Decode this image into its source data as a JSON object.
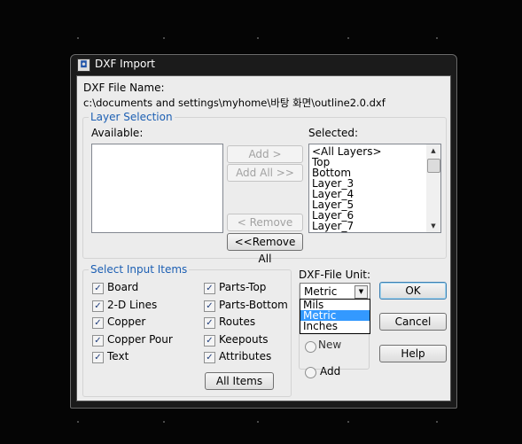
{
  "window": {
    "title": "DXF Import"
  },
  "file": {
    "label": "DXF File Name:",
    "path": "c:\\documents and settings\\myhome\\바탕 화면\\outline2.0.dxf"
  },
  "layer_selection": {
    "title": "Layer Selection",
    "available_label": "Available:",
    "selected_label": "Selected:",
    "buttons": {
      "add": "Add >",
      "add_all": "Add All >>",
      "remove": "< Remove",
      "remove_all": "<<Remove All"
    },
    "selected_items": [
      "<All Layers>",
      "Top",
      "Bottom",
      "Layer_3",
      "Layer_4",
      "Layer_5",
      "Layer_6",
      "Layer_7"
    ]
  },
  "input_items": {
    "title": "Select Input Items",
    "left": [
      {
        "label": "Board",
        "checked": true
      },
      {
        "label": "2-D Lines",
        "checked": true
      },
      {
        "label": "Copper",
        "checked": true
      },
      {
        "label": "Copper Pour",
        "checked": true
      },
      {
        "label": "Text",
        "checked": true
      }
    ],
    "right": [
      {
        "label": "Parts-Top",
        "checked": true
      },
      {
        "label": "Parts-Bottom",
        "checked": true
      },
      {
        "label": "Routes",
        "checked": true
      },
      {
        "label": "Keepouts",
        "checked": true
      },
      {
        "label": "Attributes",
        "checked": true
      }
    ],
    "all_items_button": "All  Items"
  },
  "unit": {
    "label": "DXF-File Unit:",
    "selected": "Metric",
    "options": [
      "Mils",
      "Metric",
      "Inches"
    ],
    "highlighted_option": "Metric",
    "radio_partial": "New",
    "radio_add": "Add"
  },
  "actions": {
    "ok": "OK",
    "cancel": "Cancel",
    "help": "Help"
  },
  "colors": {
    "accent": "#1c5fb3",
    "highlight": "#3399ff",
    "frame": "#1b1b1b"
  }
}
